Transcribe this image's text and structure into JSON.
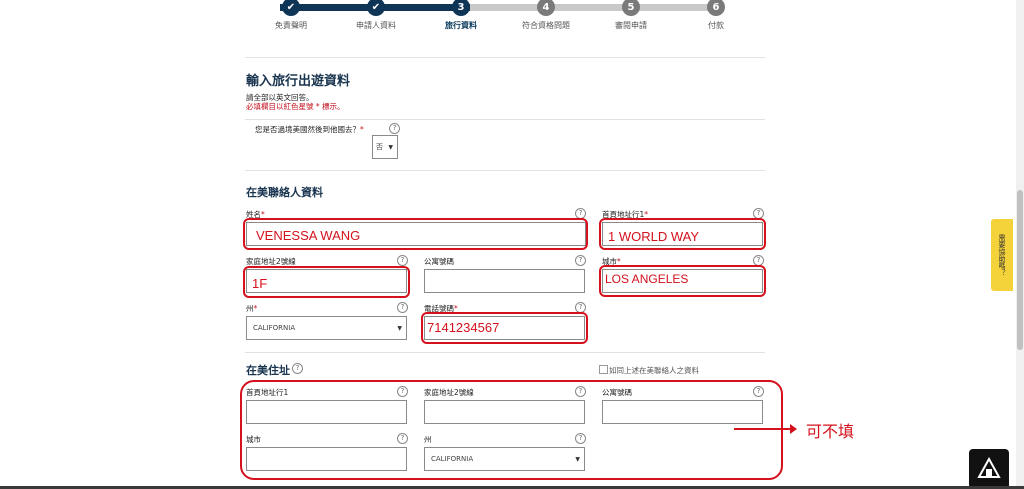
{
  "progress": {
    "steps": [
      {
        "number": "✔",
        "label": "免責聲明"
      },
      {
        "number": "✔",
        "label": "申請人資料"
      },
      {
        "number": "3",
        "label": "旅行資料"
      },
      {
        "number": "4",
        "label": "符合資格問題"
      },
      {
        "number": "5",
        "label": "審閱申請"
      },
      {
        "number": "6",
        "label": "付款"
      }
    ],
    "active_index": 2
  },
  "page": {
    "title": "輸入旅行出遊資料",
    "instruction": "請全部以英文回答。",
    "required_note": "必填欄目以紅色星號 * 標示。"
  },
  "transit": {
    "question": "您是否過境美國然後到他國去？",
    "req_mark": "*",
    "value": "否"
  },
  "contact": {
    "heading": "在美聯絡人資料",
    "name_label": "姓名",
    "addr1_label": "首頁地址行1",
    "addr2_label": "家庭地址2號線",
    "apt_label": "公寓號碼",
    "city_label": "城市",
    "state_label": "州",
    "state_value": "CALIFORNIA",
    "phone_label": "電話號碼",
    "req_mark": "*"
  },
  "annotations": {
    "name": "VENESSA WANG",
    "addr1": "1 WORLD WAY",
    "addr2": "1F",
    "city": "LOS ANGELES",
    "phone": "7141234567",
    "optional": "可不填"
  },
  "us_address": {
    "heading": "在美住址",
    "same_as_label": "如同上述在美聯絡人之資料",
    "addr1_label": "首頁地址行1",
    "addr2_label": "家庭地址2號線",
    "apt_label": "公寓號碼",
    "city_label": "城市",
    "state_label": "州",
    "state_value": "CALIFORNIA"
  },
  "sidebar": {
    "help_tab": "需要協助嗎？"
  },
  "help_glyph": "?",
  "icons": [
    "check-icon",
    "help-icon",
    "chevron-down-icon",
    "arrow-right-icon",
    "logo-icon"
  ]
}
